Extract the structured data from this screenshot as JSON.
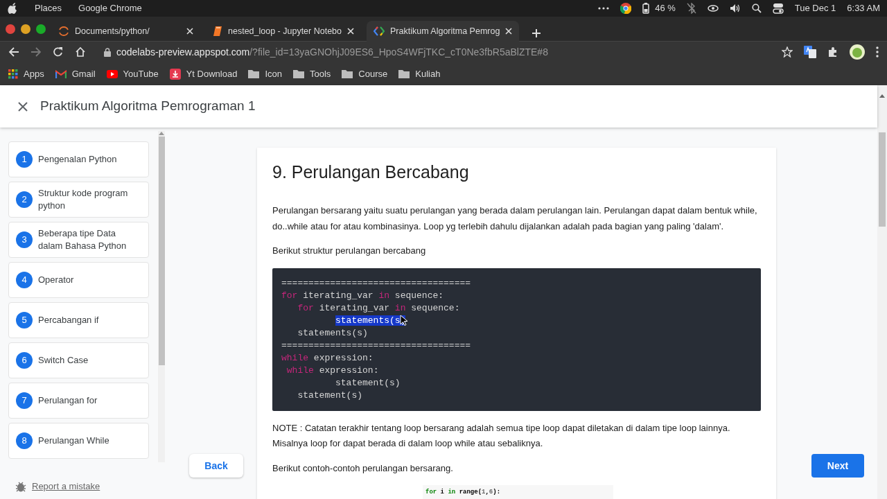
{
  "system_bar": {
    "menus": [
      "Places",
      "Google Chrome"
    ],
    "battery": "46 %",
    "date": "Tue Dec 1",
    "time": "6:33 AM"
  },
  "browser_tabs": [
    {
      "title": "Documents/python/",
      "kind": "spinner",
      "selected": false
    },
    {
      "title": "nested_loop - Jupyter Notebo",
      "kind": "notebook",
      "selected": false
    },
    {
      "title": "Praktikum Algoritma Pemrog",
      "kind": "codelabs",
      "selected": true
    }
  ],
  "address": {
    "host": "codelabs-preview.appspot.com",
    "path": "/?file_id=13yaGNOhjJ09ES6_HpoS4WFjTKC_cT0Ne3fbR5aBlZTE#8"
  },
  "bookmarks": [
    {
      "label": "Apps",
      "kind": "apps"
    },
    {
      "label": "Gmail",
      "kind": "mail"
    },
    {
      "label": "YouTube",
      "kind": "video"
    },
    {
      "label": "Yt Download",
      "kind": "download"
    },
    {
      "label": "Icon",
      "kind": "folder"
    },
    {
      "label": "Tools",
      "kind": "folder"
    },
    {
      "label": "Course",
      "kind": "folder"
    },
    {
      "label": "Kuliah",
      "kind": "folder"
    }
  ],
  "codelab": {
    "title": "Praktikum Algoritma Pemrograman 1",
    "steps": [
      {
        "number": "1",
        "label": "Pengenalan Python"
      },
      {
        "number": "2",
        "label": "Struktur kode program python"
      },
      {
        "number": "3",
        "label": "Beberapa tipe Data dalam Bahasa Python"
      },
      {
        "number": "4",
        "label": "Operator"
      },
      {
        "number": "5",
        "label": "Percabangan if"
      },
      {
        "number": "6",
        "label": "Switch Case"
      },
      {
        "number": "7",
        "label": "Perulangan for"
      },
      {
        "number": "8",
        "label": "Perulangan While"
      }
    ],
    "report": "Report a mistake",
    "back": "Back",
    "next": "Next",
    "article": {
      "heading": "9. Perulangan Bercabang",
      "blocks": [
        {
          "kind": "paragraph",
          "text": "Perulangan bersarang yaitu suatu perulangan yang berada dalam perulangan lain. Perulangan dapat dalam bentuk while, do..while atau for atau kombinasinya. Loop yg terlebih dahulu dijalankan adalah pada bagian yang paling 'dalam'."
        },
        {
          "kind": "paragraph",
          "text": "Berikut struktur perulangan bercabang"
        },
        {
          "kind": "code",
          "lines": [
            [
              {
                "text": "===================================",
                "kind": "plain"
              }
            ],
            [
              {
                "text": "for",
                "kind": "keyword"
              },
              {
                "text": " iterating_var ",
                "kind": "plain"
              },
              {
                "text": "in",
                "kind": "keyword"
              },
              {
                "text": " sequence:",
                "kind": "plain"
              }
            ],
            [
              {
                "text": "   for",
                "kind": "keyword"
              },
              {
                "text": " iterating_var ",
                "kind": "plain"
              },
              {
                "text": "in",
                "kind": "keyword"
              },
              {
                "text": " sequence:",
                "kind": "plain"
              }
            ],
            [
              {
                "text": "          statements(s)",
                "kind": "selected"
              }
            ],
            [
              {
                "text": "   statements(s)",
                "kind": "plain"
              }
            ],
            [
              {
                "text": "===================================",
                "kind": "plain"
              }
            ],
            [
              {
                "text": "while",
                "kind": "keyword"
              },
              {
                "text": " expression:",
                "kind": "plain"
              }
            ],
            [
              {
                "text": " while",
                "kind": "keyword"
              },
              {
                "text": " expression:",
                "kind": "plain"
              }
            ],
            [
              {
                "text": "          statement(s)",
                "kind": "plain"
              }
            ],
            [
              {
                "text": "   statement(s)",
                "kind": "plain"
              }
            ]
          ]
        },
        {
          "kind": "paragraph",
          "text": "NOTE : Catatan terakhir tentang loop bersarang adalah semua tipe loop dapat diletakan di dalam tipe loop lainnya. Misalnya loop for dapat berada di dalam loop while atau sebaliknya."
        },
        {
          "kind": "paragraph",
          "text": "Berikut contoh-contoh perulangan bersarang."
        },
        {
          "kind": "snippet",
          "lines": [
            [
              {
                "text": "for",
                "kind": "keyword"
              },
              {
                "text": " i ",
                "kind": "plain"
              },
              {
                "text": "in",
                "kind": "keyword"
              },
              {
                "text": " range(",
                "kind": "plain"
              },
              {
                "text": "1",
                "kind": "number"
              },
              {
                "text": ",",
                "kind": "plain"
              },
              {
                "text": "6",
                "kind": "number"
              },
              {
                "text": "):",
                "kind": "plain"
              }
            ]
          ]
        }
      ]
    }
  }
}
